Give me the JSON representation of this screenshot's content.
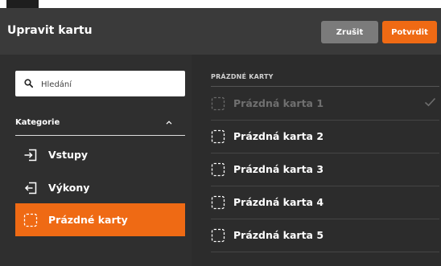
{
  "dialog": {
    "title": "Upravit kartu",
    "cancel_label": "Zrušit",
    "confirm_label": "Potvrdit"
  },
  "search": {
    "placeholder": "Hledání",
    "value": ""
  },
  "categories": {
    "heading": "Kategorie",
    "items": [
      {
        "label": "Vstupy",
        "icon": "input-icon",
        "active": false
      },
      {
        "label": "Výkony",
        "icon": "output-icon",
        "active": false
      },
      {
        "label": "Prázdné karty",
        "icon": "dashed-card-icon",
        "active": true
      }
    ]
  },
  "cards": {
    "heading": "PRÁZDNÉ KARTY",
    "items": [
      {
        "label": "Prázdná karta 1",
        "disabled": true,
        "checked": true
      },
      {
        "label": "Prázdná karta 2",
        "disabled": false,
        "checked": false
      },
      {
        "label": "Prázdná karta 3",
        "disabled": false,
        "checked": false
      },
      {
        "label": "Prázdná karta 4",
        "disabled": false,
        "checked": false
      },
      {
        "label": "Prázdná karta 5",
        "disabled": false,
        "checked": false
      }
    ]
  },
  "colors": {
    "accent": "#ef6a14",
    "cancel": "#7b7b7b",
    "background": "#2c2c2c",
    "header": "#3a3a3a"
  }
}
